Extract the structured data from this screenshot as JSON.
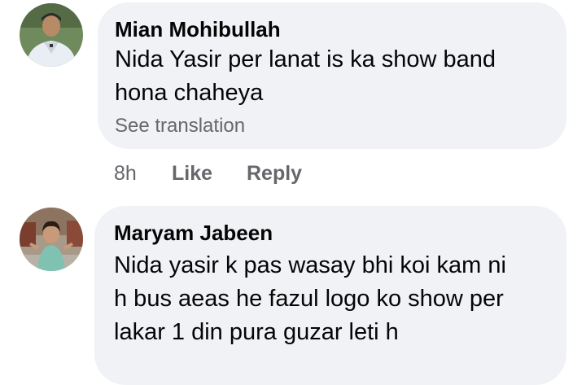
{
  "comments": [
    {
      "author": "Mian Mohibullah",
      "lines": [
        "Nida Yasir per lanat  is ka show band",
        "hona chaheya"
      ],
      "see_translation": "See translation",
      "time": "8h",
      "like_label": "Like",
      "reply_label": "Reply"
    },
    {
      "author": "Maryam Jabeen",
      "lines": [
        "Nida yasir k pas wasay bhi koi kam ni",
        "h bus aeas he fazul logo ko show per",
        "lakar 1 din pura guzar leti h"
      ]
    }
  ],
  "colors": {
    "bubble": "#f0f2f5",
    "text": "#050505",
    "secondary": "#65676b"
  }
}
